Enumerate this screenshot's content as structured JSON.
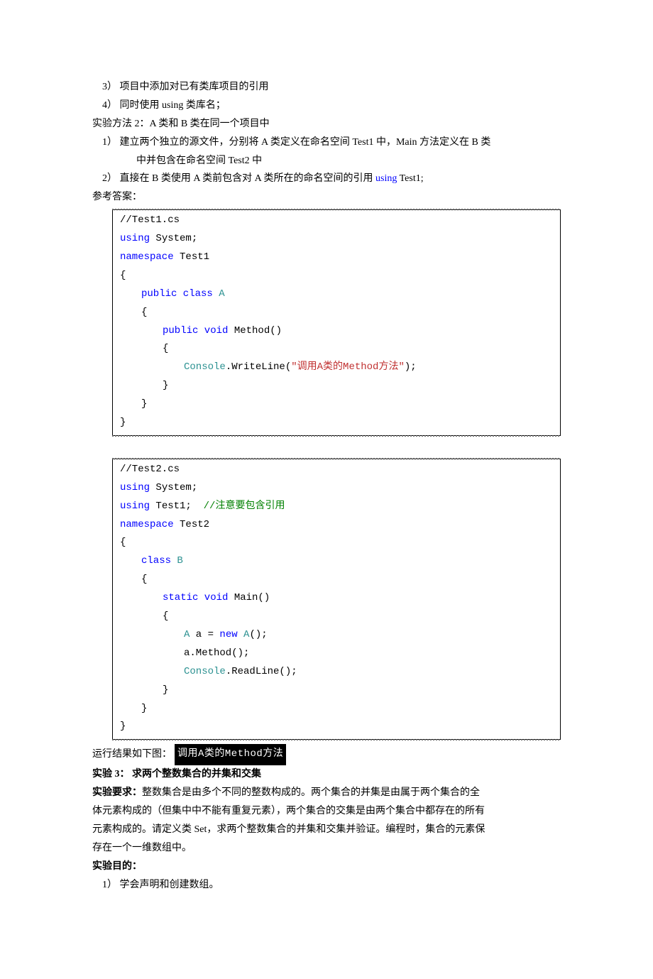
{
  "top_list": {
    "item3": "3） 项目中添加对已有类库项目的引用",
    "item4": "4） 同时使用 using 类库名；"
  },
  "method2": {
    "title": "实验方法 2：A 类和 B 类在同一个项目中",
    "step1a": "1） 建立两个独立的源文件，分别将 A 类定义在命名空间 Test1 中，Main 方法定义在 B 类",
    "step1b": "中并包含在命名空间 Test2 中",
    "step2_pre": "2） 直接在 B 类使用 A 类前包含对 A 类所在的命名空间的引用 ",
    "step2_code": "using",
    "step2_tail": " Test1;"
  },
  "answers_label": "参考答案：",
  "code1": {
    "c0": "//Test1.cs",
    "using": "using",
    "system": " System;",
    "namespace": "namespace",
    "ns": " Test1",
    "brace_o": "{",
    "public_class": "public class",
    "A": " A",
    "brace_o2": "{",
    "public_void": "public void",
    "method": " Method()",
    "brace_o3": "{",
    "console": "Console",
    "writeline": ".WriteLine(",
    "str": "\"调用A类的Method方法\"",
    "tail": ");",
    "brace_c3": "}",
    "brace_c2": "}",
    "brace_c": "}"
  },
  "code2": {
    "c0": "//Test2.cs",
    "using": "using",
    "system": " System;",
    "using2": "using",
    "test1": " Test1;  ",
    "comment": "//注意要包含引用",
    "namespace": "namespace",
    "ns": " Test2",
    "brace_o": "{",
    "class": "class",
    "B": " B",
    "brace_o2": "{",
    "static_void": "static void",
    "main": " Main()",
    "brace_o3": "{",
    "A1": "A",
    "mid": " a = ",
    "new": "new",
    "A2": " A",
    "tail1": "();",
    "line_amethod": "a.Method();",
    "console": "Console",
    "readline": ".ReadLine();",
    "brace_c3": "}",
    "brace_c2": "}",
    "brace_c": "}"
  },
  "run": {
    "label": "运行结果如下图：",
    "badge": "调用A类的Method方法"
  },
  "exp3": {
    "title": "实验 3：  求两个整数集合的并集和交集",
    "req_label": "  实验要求：",
    "req_text_a": "整数集合是由多个不同的整数构成的。两个集合的并集是由属于两个集合的全",
    "req_text_b": "体元素构成的（但集中中不能有重复元素），两个集合的交集是由两个集合中都存在的所有",
    "req_text_c": "元素构成的。请定义类 Set，求两个整数集合的并集和交集并验证。编程时，集合的元素保",
    "req_text_d": "存在一个一维数组中。",
    "purpose_label": "  实验目的：",
    "purpose_1": "1） 学会声明和创建数组。"
  }
}
